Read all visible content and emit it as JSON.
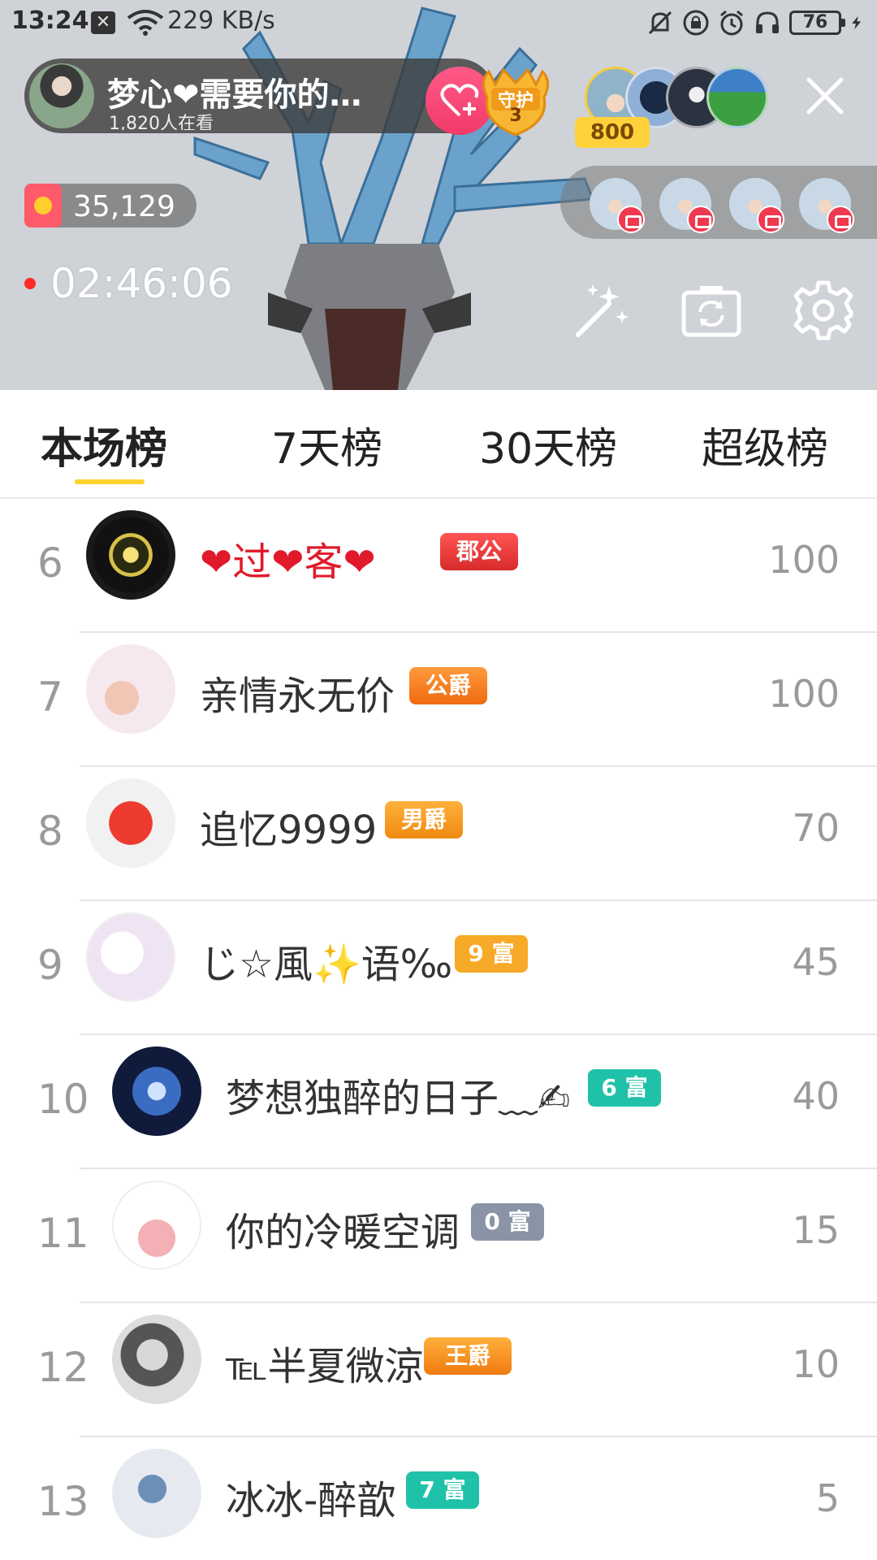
{
  "status_bar": {
    "time": "13:24",
    "network_speed": "229 KB/s",
    "battery": "76"
  },
  "host": {
    "name": "梦心❤需要你的…",
    "viewers": "1,820人在看",
    "guard_label": "守护",
    "guard_count": "3"
  },
  "viewer_count_badge": "800",
  "coins": "35,129",
  "live_duration": "02:46:06",
  "tabs": [
    "本场榜",
    "7天榜",
    "30天榜",
    "超级榜"
  ],
  "active_tab": "本场榜",
  "ranking": [
    {
      "rank": "6",
      "name": "❤过❤客❤",
      "badge": "郡公",
      "score": "100"
    },
    {
      "rank": "7",
      "name": "亲情永无价",
      "badge": "公爵",
      "score": "100"
    },
    {
      "rank": "8",
      "name": "追忆9999",
      "badge": "男爵",
      "score": "70"
    },
    {
      "rank": "9",
      "name": "じ☆風✨语‰",
      "badge": "9 富",
      "score": "45"
    },
    {
      "rank": "10",
      "name": "梦想独醉的日子﹏✍",
      "badge": "6 富",
      "score": "40"
    },
    {
      "rank": "11",
      "name": "你的冷暖空调",
      "badge": "0 富",
      "score": "15"
    },
    {
      "rank": "12",
      "name": "℡半夏微涼",
      "badge": "王爵",
      "score": "10"
    },
    {
      "rank": "13",
      "name": "冰冰-醉歆",
      "badge": "7 富",
      "score": "5"
    }
  ],
  "colors": {
    "accent_yellow": "#ffd12e",
    "follow_pink": "#f23a6a",
    "live_red": "#ff2a2a",
    "badge_duke_red": "#e83a3a",
    "badge_orange": "#ff8a1f",
    "badge_gold": "#f7a928",
    "badge_teal": "#1fc2a8",
    "badge_gray": "#8a94a6"
  }
}
